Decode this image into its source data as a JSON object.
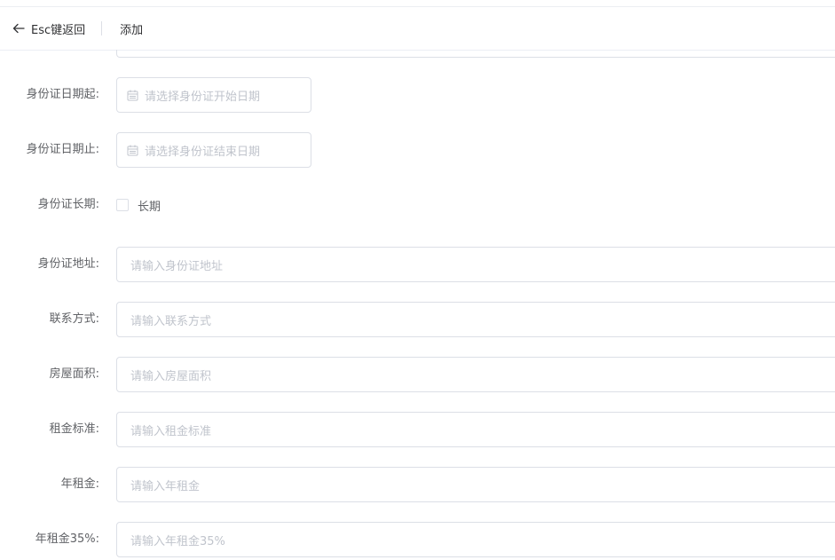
{
  "header": {
    "back_label": "Esc键返回",
    "title": "添加"
  },
  "form": {
    "id_start": {
      "label": "身份证日期起:",
      "placeholder": "请选择身份证开始日期"
    },
    "id_end": {
      "label": "身份证日期止:",
      "placeholder": "请选择身份证结束日期"
    },
    "id_long_term": {
      "label": "身份证长期:",
      "checkbox_label": "长期",
      "checked": false
    },
    "id_address": {
      "label": "身份证地址:",
      "placeholder": "请输入身份证地址"
    },
    "contact": {
      "label": "联系方式:",
      "placeholder": "请输入联系方式"
    },
    "house_area": {
      "label": "房屋面积:",
      "placeholder": "请输入房屋面积"
    },
    "rent_standard": {
      "label": "租金标准:",
      "placeholder": "请输入租金标准"
    },
    "annual_rent": {
      "label": "年租金:",
      "placeholder": "请输入年租金"
    },
    "annual_rent_35": {
      "label": "年租金35%:",
      "placeholder": "请输入年租金35%"
    }
  },
  "colors": {
    "border": "#dcdfe6",
    "placeholder": "#c0c4cc",
    "label": "#606266",
    "text": "#303133"
  }
}
